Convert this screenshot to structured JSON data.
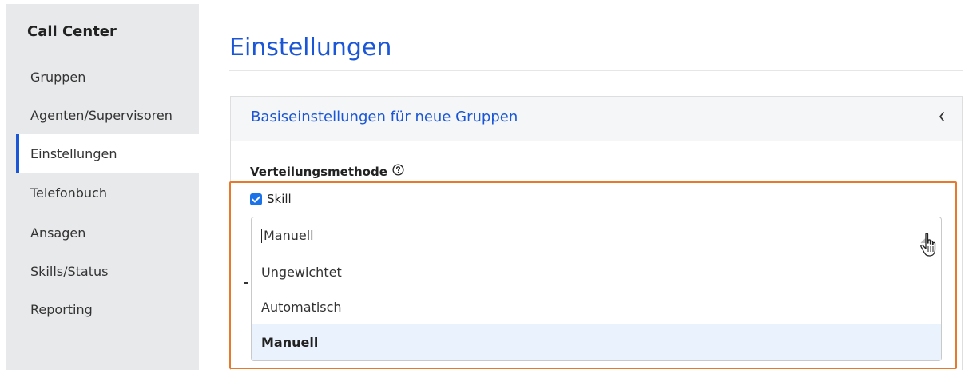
{
  "sidebar": {
    "title": "Call Center",
    "items": [
      {
        "label": "Gruppen",
        "active": false
      },
      {
        "label": "Agenten/Supervisoren",
        "active": false
      },
      {
        "label": "Einstellungen",
        "active": true
      },
      {
        "label": "Telefonbuch",
        "active": false
      },
      {
        "label": "Ansagen",
        "active": false
      },
      {
        "label": "Skills/Status",
        "active": false
      },
      {
        "label": "Reporting",
        "active": false
      }
    ]
  },
  "main": {
    "title": "Einstellungen",
    "panel": {
      "header": "Basiseinstellungen für neue Gruppen",
      "collapse_icon": "chevron-left-icon",
      "field_label": "Verteilungsmethode",
      "help_icon": "question-circle-icon",
      "checkbox": {
        "label": "Skill",
        "checked": true
      },
      "select": {
        "value": "Manuell",
        "open": true,
        "options": [
          "Ungewichtet",
          "Automatisch",
          "Manuell"
        ],
        "selected_option": "Manuell"
      }
    }
  },
  "colors": {
    "accent": "#1a56d6",
    "sidebar_bg": "#e8e9eb",
    "highlight": "#e8782a",
    "option_selected_bg": "#e9f2fd",
    "checkbox": "#1a73e8"
  }
}
